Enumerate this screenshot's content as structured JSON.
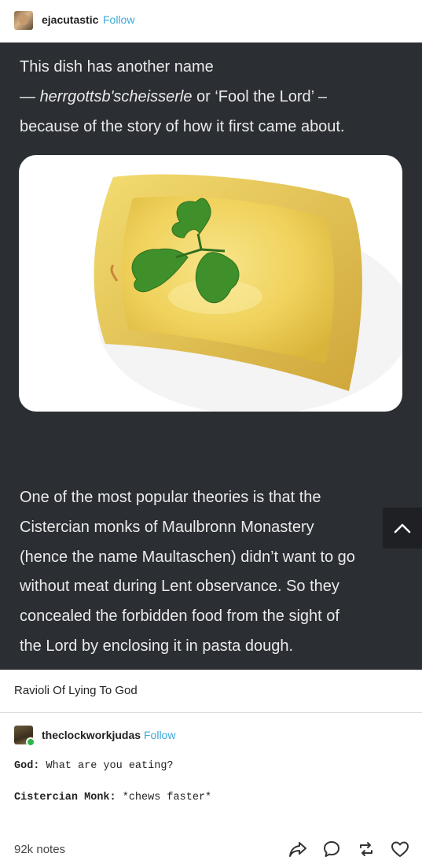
{
  "post": {
    "author": "ejacutastic",
    "follow_label": "Follow",
    "intro_line1": "This dish has another name",
    "intro_line2_prefix": "— ",
    "intro_line2_italic": "herrgottsb'scheisserle",
    "intro_line2_suffix": " or ‘Fool the Lord’ –",
    "intro_line3": "because of the story of how it first came about.",
    "body_lines": [
      "One of the most popular theories is that the",
      "Cistercian monks of Maulbronn Monastery",
      "(hence the name Maultaschen) didn’t want to go",
      "without meat during Lent observance. So they",
      "concealed the forbidden food from the sight of",
      "the Lord by enclosing it in pasta dough."
    ],
    "caption": "Ravioli Of Lying To God"
  },
  "reblog": {
    "author": "theclockworkjudas",
    "follow_label": "Follow",
    "line1_speaker": "God:",
    "line1_text": " What are you eating?",
    "line2_speaker": "Cistercian Monk:",
    "line2_text": " *chews faster*"
  },
  "footer": {
    "notes": "92k notes"
  },
  "icons": {
    "share": "share-icon",
    "reply": "reply-icon",
    "reblog": "reblog-icon",
    "like": "heart-icon",
    "scroll_top": "chevron-up-icon"
  },
  "colors": {
    "follow": "#3aa9d8",
    "dark_bg": "#2b2e33",
    "pasta": "#f2d86a",
    "parsley": "#3f8f2a"
  }
}
